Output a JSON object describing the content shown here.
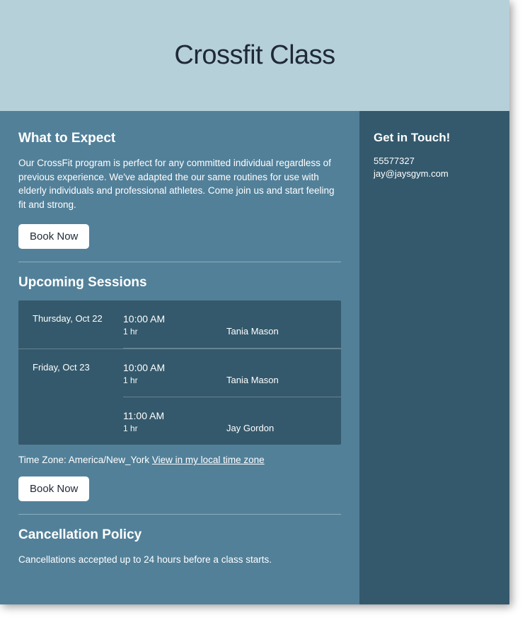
{
  "header": {
    "title": "Crossfit Class"
  },
  "main": {
    "expect": {
      "heading": "What to Expect",
      "description": "Our CrossFit program is perfect for any committed individual regardless of previous experience. We've adapted the our same routines for use with elderly individuals and professional athletes. Come join us and start feeling fit and strong.",
      "book_label": "Book Now"
    },
    "sessions": {
      "heading": "Upcoming Sessions",
      "rows": [
        {
          "date": "Thursday, Oct 22",
          "slots": [
            {
              "time": "10:00 AM",
              "duration": "1 hr",
              "instructor": "Tania Mason"
            }
          ]
        },
        {
          "date": "Friday, Oct 23",
          "slots": [
            {
              "time": "10:00 AM",
              "duration": "1 hr",
              "instructor": "Tania Mason"
            },
            {
              "time": "11:00 AM",
              "duration": "1 hr",
              "instructor": "Jay Gordon"
            }
          ]
        }
      ],
      "timezone_label": "Time Zone: America/New_York",
      "timezone_link": "View in my local time zone",
      "book_label": "Book Now"
    },
    "cancellation": {
      "heading": "Cancellation Policy",
      "text": "Cancellations accepted up to 24 hours before a class starts."
    }
  },
  "sidebar": {
    "heading": "Get in Touch!",
    "phone": "55577327",
    "email": "jay@jaysgym.com"
  }
}
